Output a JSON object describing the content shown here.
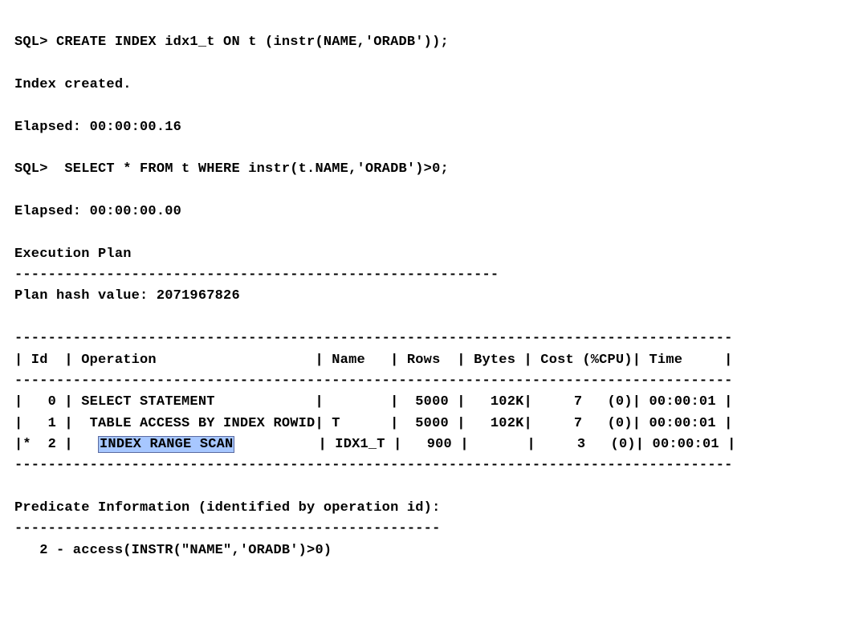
{
  "lines": {
    "l1": "SQL> CREATE INDEX idx1_t ON t (instr(NAME,'ORADB'));",
    "l2": "Index created.",
    "l3": "Elapsed: 00:00:00.16",
    "l4": "SQL>  SELECT * FROM t WHERE instr(t.NAME,'ORADB')>0;",
    "l5": "Elapsed: 00:00:00.00",
    "l6": "Execution Plan",
    "l7": "----------------------------------------------------------",
    "l8": "Plan hash value: 2071967826",
    "l9": "--------------------------------------------------------------------------------------",
    "l10": "| Id  | Operation                   | Name   | Rows  | Bytes | Cost (%CPU)| Time     |",
    "l11": "--------------------------------------------------------------------------------------",
    "l12": "|   0 | SELECT STATEMENT            |        |  5000 |   102K|     7   (0)| 00:00:01 |",
    "l13": "|   1 |  TABLE ACCESS BY INDEX ROWID| T      |  5000 |   102K|     7   (0)| 00:00:01 |",
    "l14a": "|*  2 |   ",
    "l14b": "INDEX RANGE SCAN",
    "l14c": "          | IDX1_T |   900 |       |     3   (0)| 00:00:01 |",
    "l15": "--------------------------------------------------------------------------------------",
    "l16": "Predicate Information (identified by operation id):",
    "l17": "---------------------------------------------------",
    "l18": "   2 - access(INSTR(\"NAME\",'ORADB')>0)"
  },
  "chart_data": {
    "type": "table",
    "title": "Execution Plan",
    "plan_hash_value": 2071967826,
    "columns": [
      "Id",
      "Operation",
      "Name",
      "Rows",
      "Bytes",
      "Cost (%CPU)",
      "Time"
    ],
    "rows": [
      {
        "Id": "0",
        "Operation": "SELECT STATEMENT",
        "Name": "",
        "Rows": 5000,
        "Bytes": "102K",
        "Cost (%CPU)": "7   (0)",
        "Time": "00:00:01"
      },
      {
        "Id": "1",
        "Operation": "TABLE ACCESS BY INDEX ROWID",
        "Name": "T",
        "Rows": 5000,
        "Bytes": "102K",
        "Cost (%CPU)": "7   (0)",
        "Time": "00:00:01"
      },
      {
        "Id": "*2",
        "Operation": "INDEX RANGE SCAN",
        "Name": "IDX1_T",
        "Rows": 900,
        "Bytes": "",
        "Cost (%CPU)": "3   (0)",
        "Time": "00:00:01"
      }
    ],
    "predicate_information": [
      "2 - access(INSTR(\"NAME\",'ORADB')>0)"
    ]
  }
}
